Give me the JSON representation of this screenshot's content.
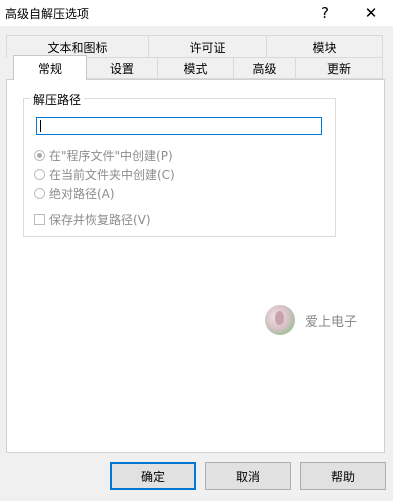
{
  "window": {
    "title": "高级自解压选项",
    "help_glyph": "?",
    "close_glyph": "✕"
  },
  "tabs": {
    "row1": [
      "文本和图标",
      "许可证",
      "模块"
    ],
    "row2": [
      "常规",
      "设置",
      "模式",
      "高级",
      "更新"
    ],
    "active": "常规"
  },
  "extract_path": {
    "group_label": "解压路径",
    "value": "",
    "options": [
      {
        "label": "在\"程序文件\"中创建(P)",
        "checked": true
      },
      {
        "label": "在当前文件夹中创建(C)",
        "checked": false
      },
      {
        "label": "绝对路径(A)",
        "checked": false
      }
    ],
    "save_restore_label": "保存并恢复路径(V)",
    "save_restore_checked": false
  },
  "watermark": {
    "text": "爱上电子"
  },
  "buttons": {
    "ok": "确定",
    "cancel": "取消",
    "help": "帮助"
  },
  "colors": {
    "accent": "#0078d7",
    "disabled_text": "#8d8d8d",
    "dialog_bg": "#f0f0f0"
  }
}
